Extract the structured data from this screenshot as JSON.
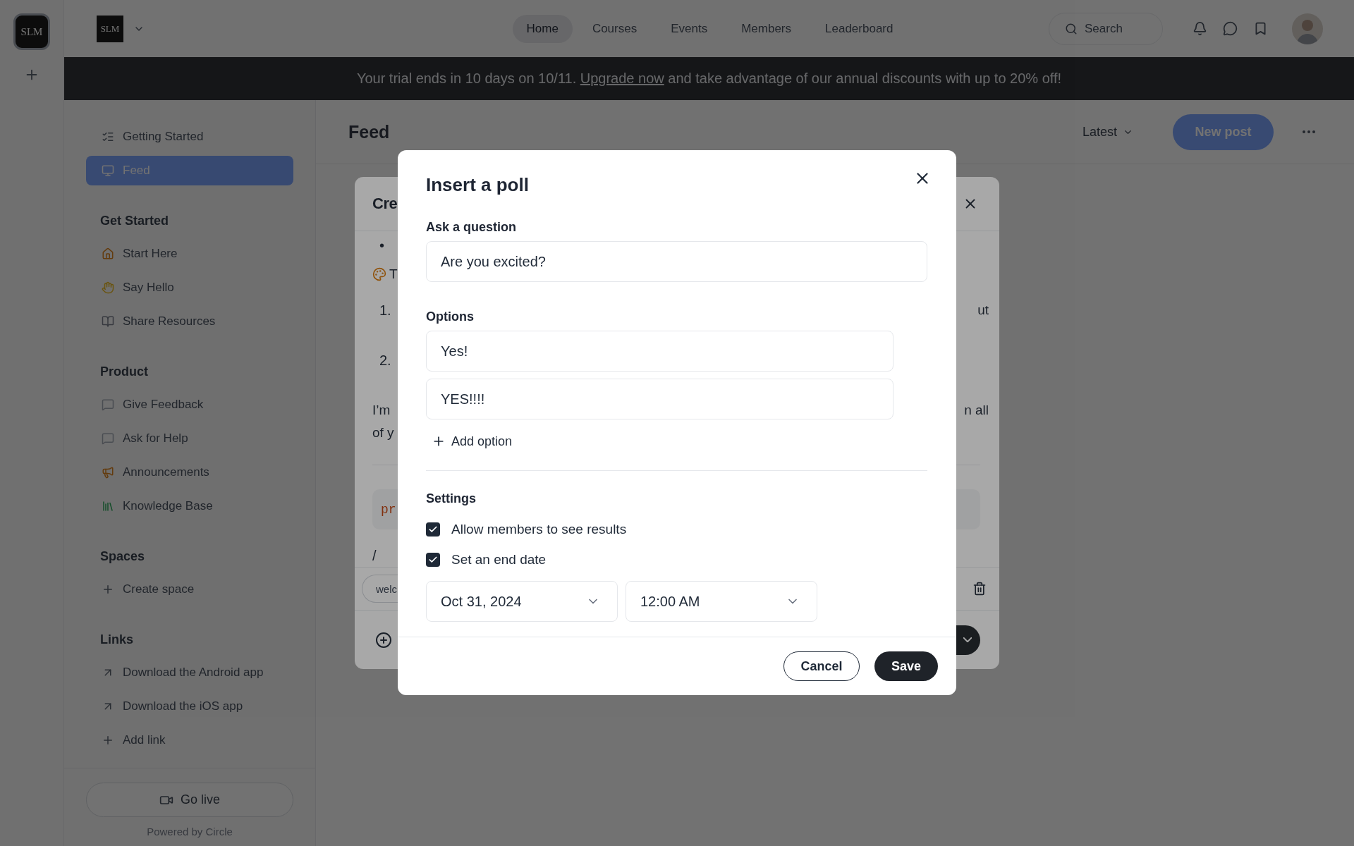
{
  "rail": {
    "logo": "SLM"
  },
  "header": {
    "logo": "SLM",
    "nav": [
      {
        "label": "Home",
        "selected": true
      },
      {
        "label": "Courses",
        "selected": false
      },
      {
        "label": "Events",
        "selected": false
      },
      {
        "label": "Members",
        "selected": false
      },
      {
        "label": "Leaderboard",
        "selected": false
      }
    ],
    "search": {
      "placeholder": "Search"
    }
  },
  "banner": {
    "before": "Your trial ends in 10 days on 10/11.",
    "link": "Upgrade now",
    "after": "and take advantage of our annual discounts with up to 20% off!"
  },
  "sidebar": {
    "items": [
      {
        "label": "Getting Started",
        "selected": false
      },
      {
        "label": "Feed",
        "selected": true
      }
    ],
    "sections": [
      {
        "title": "Get Started",
        "items": [
          {
            "label": "Start Here"
          },
          {
            "label": "Say Hello"
          },
          {
            "label": "Share Resources"
          }
        ]
      },
      {
        "title": "Product",
        "items": [
          {
            "label": "Give Feedback"
          },
          {
            "label": "Ask for Help"
          },
          {
            "label": "Announcements"
          },
          {
            "label": "Knowledge Base"
          }
        ]
      },
      {
        "title": "Spaces",
        "items": [
          {
            "label": "Create space"
          }
        ]
      },
      {
        "title": "Links",
        "items": [
          {
            "label": "Download the Android app"
          },
          {
            "label": "Download the iOS app"
          },
          {
            "label": "Add link"
          }
        ]
      }
    ],
    "go_live": "Go live",
    "powered_by": "Powered by Circle"
  },
  "feed_header": {
    "title": "Feed",
    "sort": "Latest",
    "new_post": "New post"
  },
  "composer": {
    "title": "Cre",
    "rows": [
      {
        "kind": "bullet",
        "marker": "•"
      },
      {
        "kind": "emoji",
        "left": "T"
      },
      {
        "kind": "numbered",
        "marker": "1.",
        "right": "ut"
      },
      {
        "kind": "numbered",
        "marker": "2."
      },
      {
        "kind": "text",
        "left": "I’m",
        "right": "n all"
      },
      {
        "kind": "text",
        "left": "of y"
      }
    ],
    "code": "pr",
    "slash": "/",
    "chip": "welc"
  },
  "poll_dialog": {
    "title": "Insert a poll",
    "question_label": "Ask a question",
    "question": "Are you excited?",
    "options_label": "Options",
    "options": [
      "Yes!",
      "YES!!!!"
    ],
    "add_option": "Add option",
    "settings_label": "Settings",
    "settings": [
      {
        "label": "Allow members to see results",
        "checked": true
      },
      {
        "label": "Set an end date",
        "checked": true
      }
    ],
    "end_date": "Oct 31, 2024",
    "end_time": "12:00 AM",
    "cancel": "Cancel",
    "save": "Save"
  }
}
